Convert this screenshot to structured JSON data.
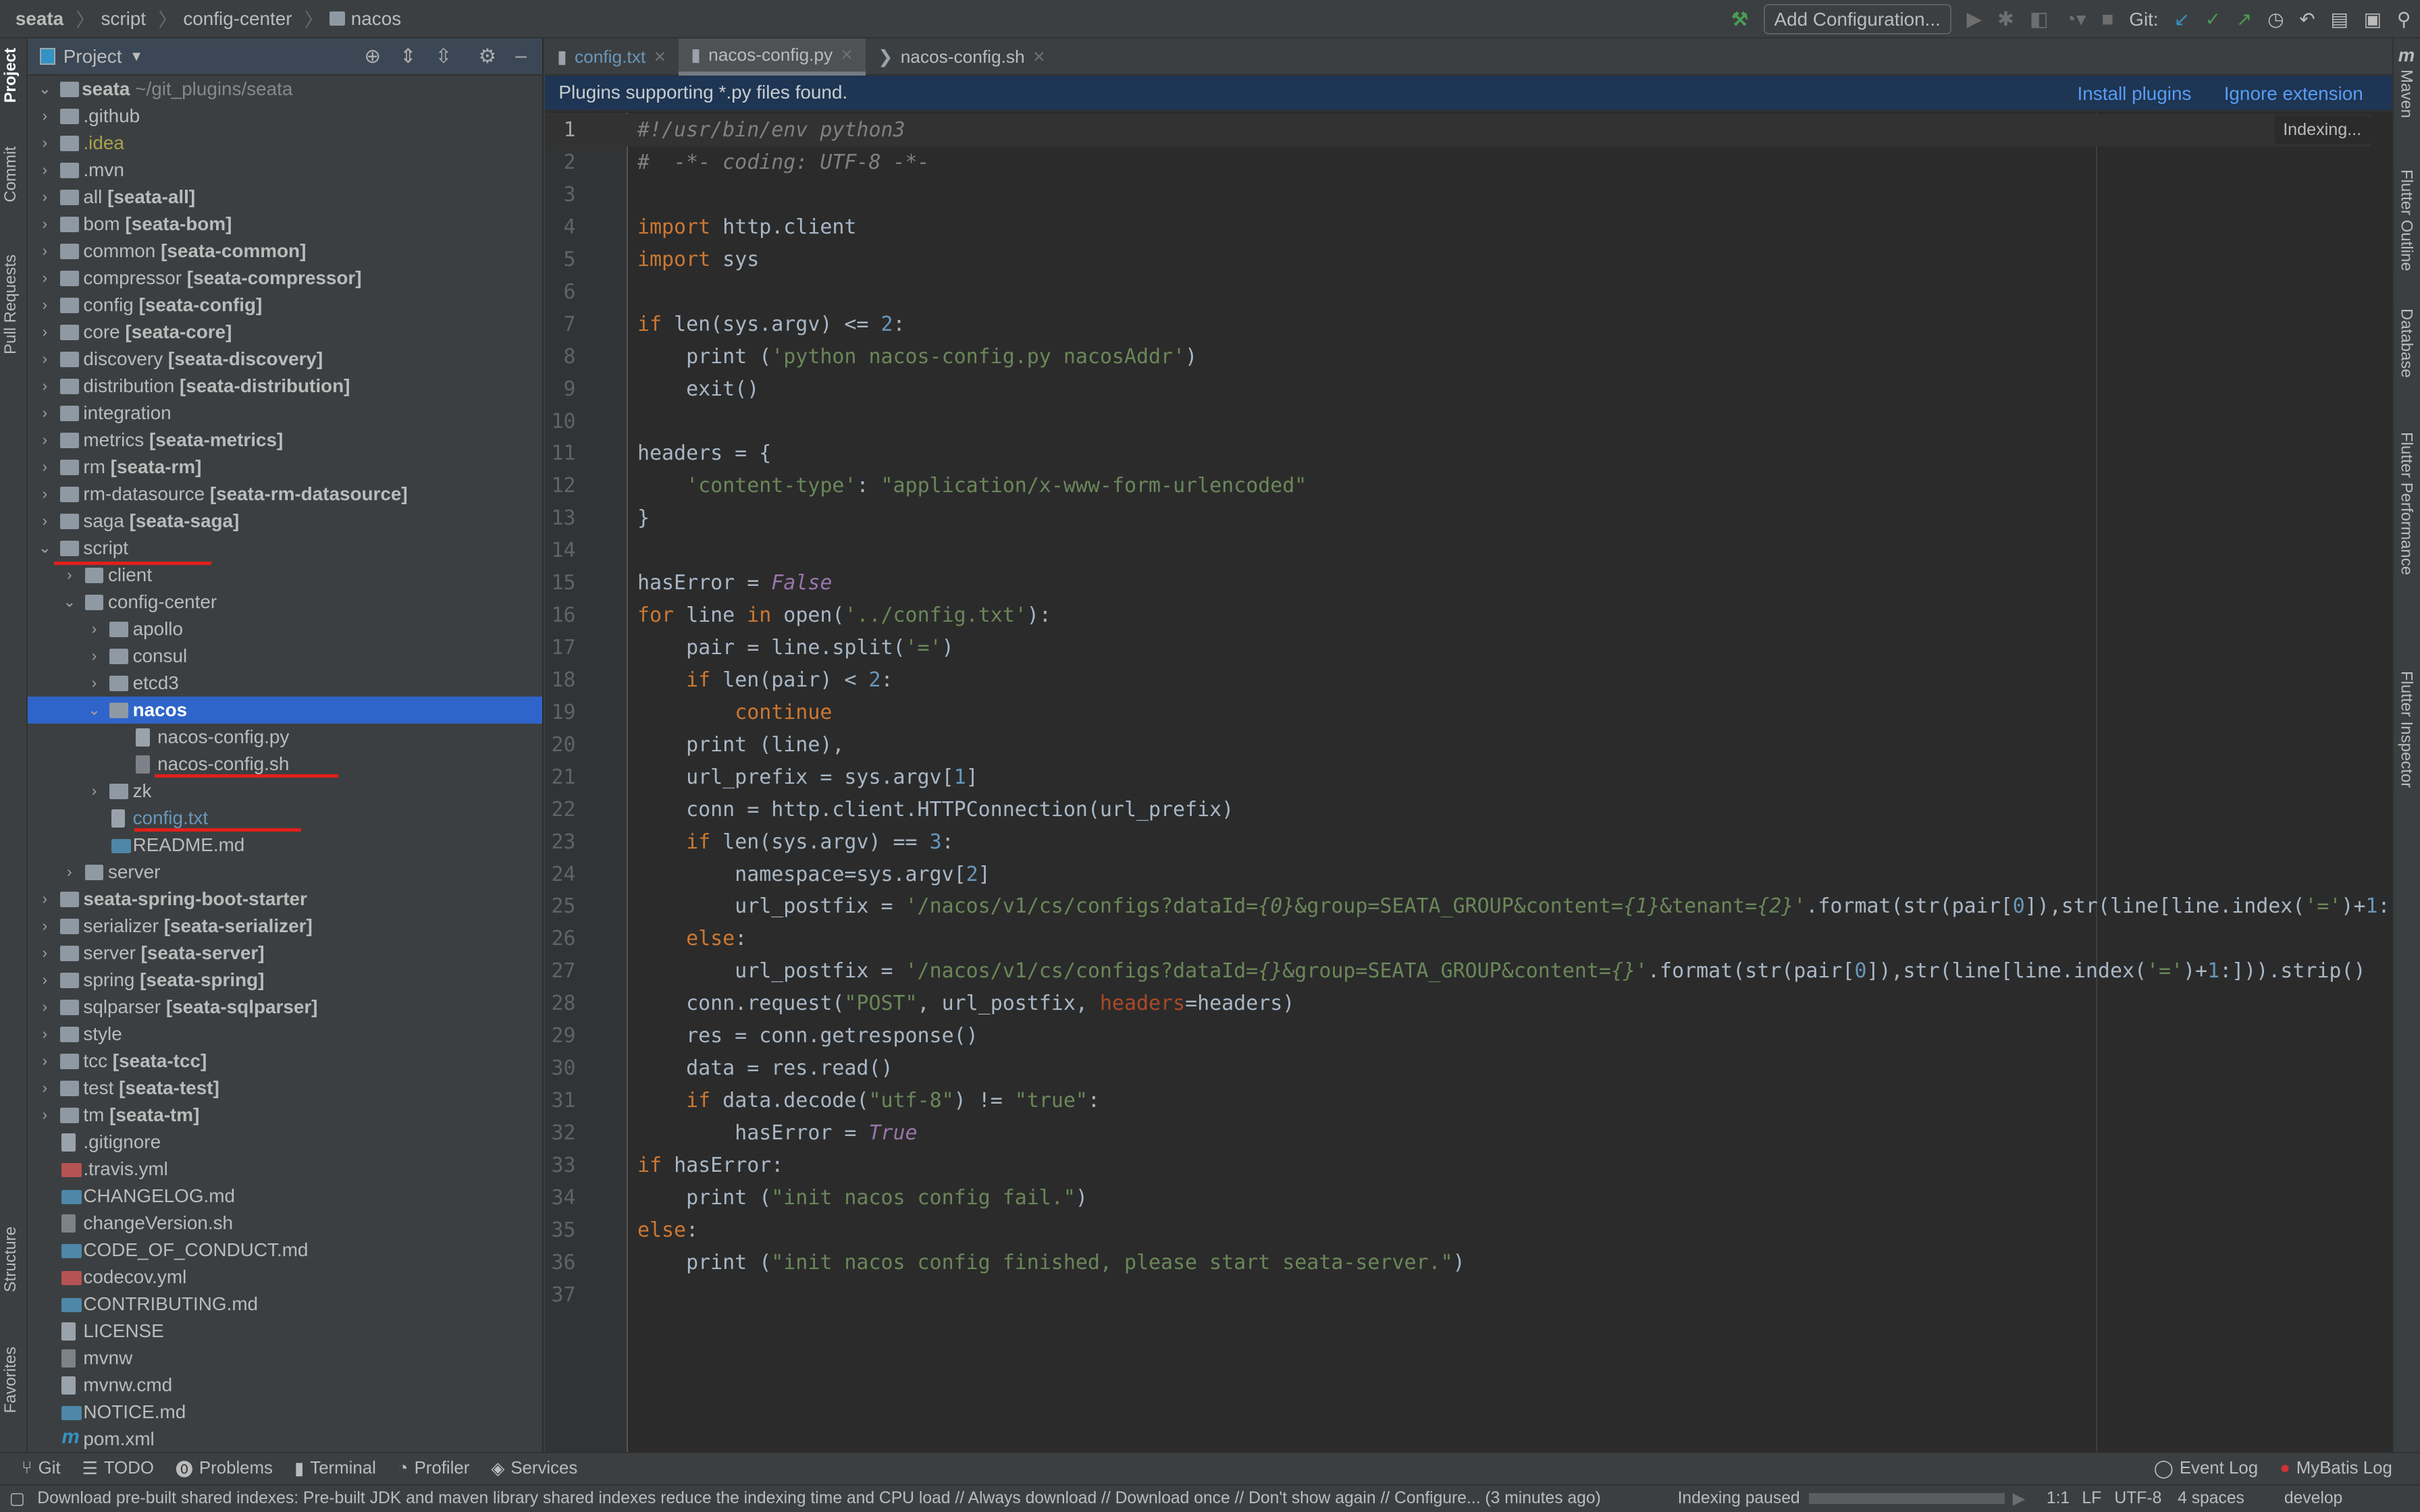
{
  "breadcrumb": [
    "seata",
    "script",
    "config-center",
    "nacos"
  ],
  "toolbar": {
    "add_configuration": "Add Configuration...",
    "git_label": "Git:"
  },
  "left_strip": [
    "Project",
    "Commit",
    "Pull Requests",
    "Structure",
    "Favorites"
  ],
  "right_strip": [
    "Maven",
    "Flutter Outline",
    "Database",
    "Flutter Performance",
    "Flutter Inspector"
  ],
  "project_panel": {
    "title": "Project",
    "root": {
      "name": "seata",
      "path": "~/git_plugins/seata"
    },
    "items": [
      {
        "name": ".github",
        "module": "",
        "depth": 0,
        "kind": "folder"
      },
      {
        "name": ".idea",
        "module": "",
        "depth": 0,
        "kind": "folder",
        "color": "#a8a34e"
      },
      {
        "name": ".mvn",
        "module": "",
        "depth": 0,
        "kind": "folder"
      },
      {
        "name": "all ",
        "module": "[seata-all]",
        "depth": 0,
        "kind": "folder"
      },
      {
        "name": "bom ",
        "module": "[seata-bom]",
        "depth": 0,
        "kind": "folder"
      },
      {
        "name": "common ",
        "module": "[seata-common]",
        "depth": 0,
        "kind": "folder"
      },
      {
        "name": "compressor ",
        "module": "[seata-compressor]",
        "depth": 0,
        "kind": "folder"
      },
      {
        "name": "config ",
        "module": "[seata-config]",
        "depth": 0,
        "kind": "folder"
      },
      {
        "name": "core ",
        "module": "[seata-core]",
        "depth": 0,
        "kind": "folder"
      },
      {
        "name": "discovery ",
        "module": "[seata-discovery]",
        "depth": 0,
        "kind": "folder"
      },
      {
        "name": "distribution ",
        "module": "[seata-distribution]",
        "depth": 0,
        "kind": "folder"
      },
      {
        "name": "integration",
        "module": "",
        "depth": 0,
        "kind": "folder"
      },
      {
        "name": "metrics ",
        "module": "[seata-metrics]",
        "depth": 0,
        "kind": "folder"
      },
      {
        "name": "rm ",
        "module": "[seata-rm]",
        "depth": 0,
        "kind": "folder"
      },
      {
        "name": "rm-datasource ",
        "module": "[seata-rm-datasource]",
        "depth": 0,
        "kind": "folder"
      },
      {
        "name": "saga ",
        "module": "[seata-saga]",
        "depth": 0,
        "kind": "folder"
      },
      {
        "name": "script",
        "module": "",
        "depth": 0,
        "kind": "folder",
        "expanded": true
      },
      {
        "name": "client",
        "module": "",
        "depth": 1,
        "kind": "folder"
      },
      {
        "name": "config-center",
        "module": "",
        "depth": 1,
        "kind": "folder",
        "expanded": true
      },
      {
        "name": "apollo",
        "module": "",
        "depth": 2,
        "kind": "folder"
      },
      {
        "name": "consul",
        "module": "",
        "depth": 2,
        "kind": "folder"
      },
      {
        "name": "etcd3",
        "module": "",
        "depth": 2,
        "kind": "folder"
      },
      {
        "name": "",
        "module": "nacos",
        "depth": 2,
        "kind": "folder",
        "expanded": true,
        "selected": true
      },
      {
        "name": "nacos-config.py",
        "module": "",
        "depth": 3,
        "kind": "file",
        "icon": "file"
      },
      {
        "name": "nacos-config.sh",
        "module": "",
        "depth": 3,
        "kind": "file",
        "icon": "sh"
      },
      {
        "name": "zk",
        "module": "",
        "depth": 2,
        "kind": "folder"
      },
      {
        "name": "config.txt",
        "module": "",
        "depth": 2,
        "kind": "file",
        "icon": "file",
        "color": "#6897bb"
      },
      {
        "name": "README.md",
        "module": "",
        "depth": 2,
        "kind": "file",
        "icon": "md"
      },
      {
        "name": "server",
        "module": "",
        "depth": 1,
        "kind": "folder"
      },
      {
        "name": "",
        "module": "seata-spring-boot-starter",
        "depth": 0,
        "kind": "folder"
      },
      {
        "name": "serializer ",
        "module": "[seata-serializer]",
        "depth": 0,
        "kind": "folder"
      },
      {
        "name": "server ",
        "module": "[seata-server]",
        "depth": 0,
        "kind": "folder"
      },
      {
        "name": "spring ",
        "module": "[seata-spring]",
        "depth": 0,
        "kind": "folder"
      },
      {
        "name": "sqlparser ",
        "module": "[seata-sqlparser]",
        "depth": 0,
        "kind": "folder"
      },
      {
        "name": "style",
        "module": "",
        "depth": 0,
        "kind": "folder"
      },
      {
        "name": "tcc ",
        "module": "[seata-tcc]",
        "depth": 0,
        "kind": "folder"
      },
      {
        "name": "test ",
        "module": "[seata-test]",
        "depth": 0,
        "kind": "folder"
      },
      {
        "name": "tm ",
        "module": "[seata-tm]",
        "depth": 0,
        "kind": "folder"
      },
      {
        "name": ".gitignore",
        "module": "",
        "depth": 0,
        "kind": "file",
        "icon": "file"
      },
      {
        "name": ".travis.yml",
        "module": "",
        "depth": 0,
        "kind": "file",
        "icon": "yml"
      },
      {
        "name": "CHANGELOG.md",
        "module": "",
        "depth": 0,
        "kind": "file",
        "icon": "md"
      },
      {
        "name": "changeVersion.sh",
        "module": "",
        "depth": 0,
        "kind": "file",
        "icon": "sh"
      },
      {
        "name": "CODE_OF_CONDUCT.md",
        "module": "",
        "depth": 0,
        "kind": "file",
        "icon": "md"
      },
      {
        "name": "codecov.yml",
        "module": "",
        "depth": 0,
        "kind": "file",
        "icon": "yml"
      },
      {
        "name": "CONTRIBUTING.md",
        "module": "",
        "depth": 0,
        "kind": "file",
        "icon": "md"
      },
      {
        "name": "LICENSE",
        "module": "",
        "depth": 0,
        "kind": "file",
        "icon": "file"
      },
      {
        "name": "mvnw",
        "module": "",
        "depth": 0,
        "kind": "file",
        "icon": "sh"
      },
      {
        "name": "mvnw.cmd",
        "module": "",
        "depth": 0,
        "kind": "file",
        "icon": "file"
      },
      {
        "name": "NOTICE.md",
        "module": "",
        "depth": 0,
        "kind": "file",
        "icon": "md"
      },
      {
        "name": "pom.xml",
        "module": "",
        "depth": 0,
        "kind": "file",
        "icon": "xml"
      }
    ]
  },
  "tabs": [
    {
      "label": "config.txt",
      "color": "#6897bb"
    },
    {
      "label": "nacos-config.py",
      "active": true
    },
    {
      "label": "nacos-config.sh"
    }
  ],
  "banner": {
    "message": "Plugins supporting *.py files found.",
    "install": "Install plugins",
    "ignore": "Ignore extension"
  },
  "indexing_popup": "Indexing...",
  "code": [
    [
      [
        "#!/usr/bin/env python3",
        "c"
      ]
    ],
    [
      [
        "#  -*- coding: UTF-8 -*-",
        "c"
      ]
    ],
    [],
    [
      [
        "import",
        "k"
      ],
      [
        " http.client",
        ""
      ]
    ],
    [
      [
        "import",
        "k"
      ],
      [
        " sys",
        ""
      ]
    ],
    [],
    [
      [
        "if",
        "k"
      ],
      [
        " len(sys.argv) <= ",
        ""
      ],
      [
        "2",
        "n"
      ],
      [
        ":",
        ""
      ]
    ],
    [
      [
        "    print (",
        ""
      ],
      [
        "'python nacos-config.py nacosAddr'",
        "s"
      ],
      [
        ")",
        ""
      ]
    ],
    [
      [
        "    exit()",
        ""
      ]
    ],
    [],
    [
      [
        "headers = {",
        ""
      ]
    ],
    [
      [
        "    ",
        ""
      ],
      [
        "'content-type'",
        "s"
      ],
      [
        ": ",
        ""
      ],
      [
        "\"application/x-www-form-urlencoded\"",
        "s"
      ]
    ],
    [
      [
        "}",
        ""
      ]
    ],
    [],
    [
      [
        "hasError = ",
        ""
      ],
      [
        "False",
        "p"
      ]
    ],
    [
      [
        "for",
        "k"
      ],
      [
        " line ",
        ""
      ],
      [
        "in",
        "k"
      ],
      [
        " open(",
        ""
      ],
      [
        "'../config.txt'",
        "s"
      ],
      [
        "):",
        ""
      ]
    ],
    [
      [
        "    pair = line.split(",
        ""
      ],
      [
        "'='",
        "s"
      ],
      [
        ")",
        ""
      ]
    ],
    [
      [
        "    ",
        ""
      ],
      [
        "if",
        "k"
      ],
      [
        " len(pair) < ",
        ""
      ],
      [
        "2",
        "n"
      ],
      [
        ":",
        ""
      ]
    ],
    [
      [
        "        ",
        ""
      ],
      [
        "continue",
        "k"
      ]
    ],
    [
      [
        "    print (line),",
        ""
      ]
    ],
    [
      [
        "    url_prefix = sys.argv[",
        ""
      ],
      [
        "1",
        "n"
      ],
      [
        "]",
        ""
      ]
    ],
    [
      [
        "    conn = http.client.HTTPConnection(url_prefix)",
        ""
      ]
    ],
    [
      [
        "    ",
        ""
      ],
      [
        "if",
        "k"
      ],
      [
        " len(sys.argv) == ",
        ""
      ],
      [
        "3",
        "n"
      ],
      [
        ":",
        ""
      ]
    ],
    [
      [
        "        namespace=sys.argv[",
        ""
      ],
      [
        "2",
        "n"
      ],
      [
        "]",
        ""
      ]
    ],
    [
      [
        "        url_postfix = ",
        ""
      ],
      [
        "'/nacos/v1/cs/configs?dataId=",
        "s"
      ],
      [
        "{0}",
        "si"
      ],
      [
        "&group=SEATA_GROUP&content=",
        "s"
      ],
      [
        "{1}",
        "si"
      ],
      [
        "&tenant=",
        "s"
      ],
      [
        "{2}",
        "si"
      ],
      [
        "'",
        "s"
      ],
      [
        ".format(str(pair[",
        ""
      ],
      [
        "0",
        "n"
      ],
      [
        "]),str(line[line.index(",
        ""
      ],
      [
        "'='",
        "s"
      ],
      [
        ")+",
        ""
      ],
      [
        "1",
        "n"
      ],
      [
        ":",
        ""
      ]
    ],
    [
      [
        "    ",
        ""
      ],
      [
        "else",
        "k"
      ],
      [
        ":",
        ""
      ]
    ],
    [
      [
        "        url_postfix = ",
        ""
      ],
      [
        "'/nacos/v1/cs/configs?dataId=",
        "s"
      ],
      [
        "{}",
        "si"
      ],
      [
        "&group=SEATA_GROUP&content=",
        "s"
      ],
      [
        "{}",
        "si"
      ],
      [
        "'",
        "s"
      ],
      [
        ".format(str(pair[",
        ""
      ],
      [
        "0",
        "n"
      ],
      [
        "]),str(line[line.index(",
        ""
      ],
      [
        "'='",
        "s"
      ],
      [
        ")+",
        ""
      ],
      [
        "1",
        "n"
      ],
      [
        ":])).strip()",
        ""
      ]
    ],
    [
      [
        "    conn.request(",
        ""
      ],
      [
        "\"POST\"",
        "s"
      ],
      [
        ", url_postfix, ",
        ""
      ],
      [
        "headers",
        "a"
      ],
      [
        "=headers)",
        ""
      ]
    ],
    [
      [
        "    res = conn.getresponse()",
        ""
      ]
    ],
    [
      [
        "    data = res.read()",
        ""
      ]
    ],
    [
      [
        "    ",
        ""
      ],
      [
        "if",
        "k"
      ],
      [
        " data.decode(",
        ""
      ],
      [
        "\"utf-8\"",
        "s"
      ],
      [
        ") != ",
        ""
      ],
      [
        "\"true\"",
        "s"
      ],
      [
        ":",
        ""
      ]
    ],
    [
      [
        "        hasError = ",
        ""
      ],
      [
        "True",
        "p"
      ]
    ],
    [
      [
        "if",
        "k"
      ],
      [
        " hasError:",
        ""
      ]
    ],
    [
      [
        "    print (",
        ""
      ],
      [
        "\"init nacos config fail.\"",
        "s"
      ],
      [
        ")",
        ""
      ]
    ],
    [
      [
        "else",
        "k"
      ],
      [
        ":",
        ""
      ]
    ],
    [
      [
        "    print (",
        ""
      ],
      [
        "\"init nacos config finished, please start seata-server.\"",
        "s"
      ],
      [
        ")",
        ""
      ]
    ],
    []
  ],
  "bottom_tools": {
    "left": [
      "Git",
      "TODO",
      "Problems",
      "Terminal",
      "Profiler",
      "Services"
    ],
    "right": [
      "Event Log",
      "MyBatis Log"
    ]
  },
  "status": {
    "message": "Download pre-built shared indexes: Pre-built JDK and maven library shared indexes reduce the indexing time and CPU load // Always download // Download once // Don't show again // Configure... (3 minutes ago)",
    "indexing": "Indexing paused",
    "position": "1:1",
    "line_sep": "LF",
    "encoding": "UTF-8",
    "indent": "4 spaces",
    "branch": "develop"
  },
  "colors": {
    "selection": "#2f65ca",
    "banner": "#1e3553",
    "link": "#589df6",
    "annotation_underline": "#e0201b"
  }
}
